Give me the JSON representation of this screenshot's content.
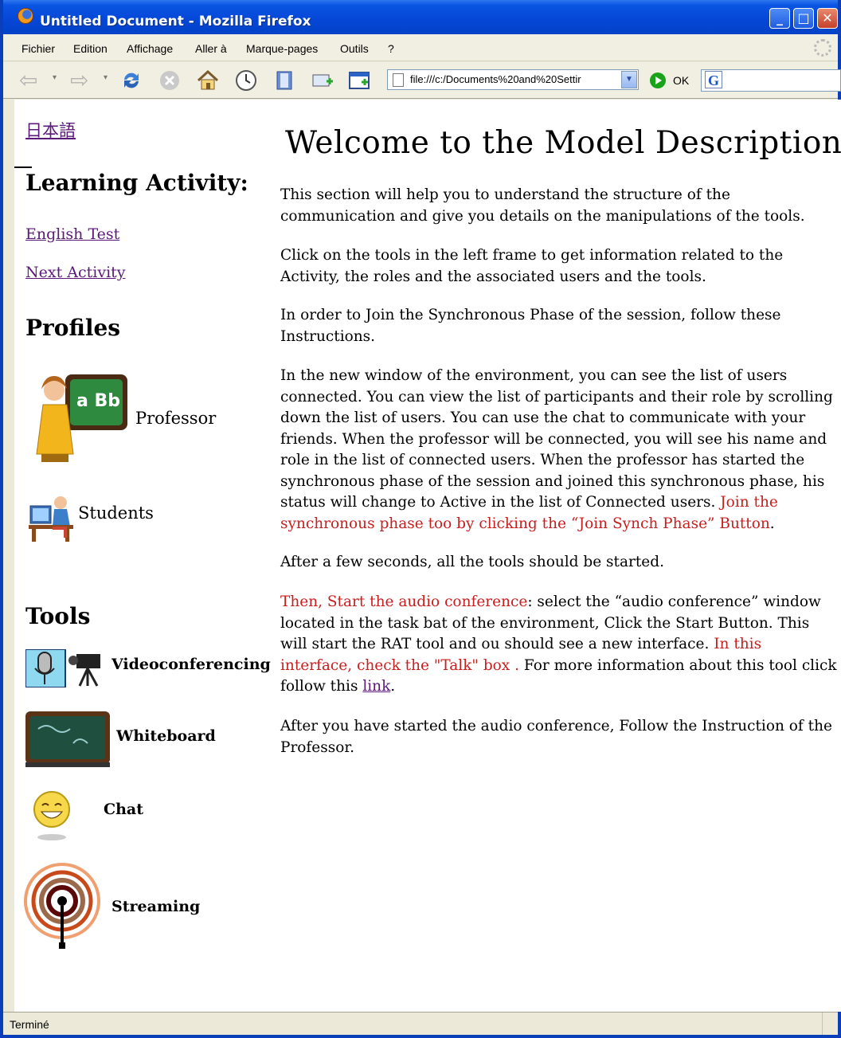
{
  "window": {
    "title": "Untitled Document - Mozilla Firefox",
    "controls": {
      "minimize": "_",
      "maximize": "□",
      "close": "✕"
    }
  },
  "menu": [
    "Fichier",
    "Edition",
    "Affichage",
    "Aller à",
    "Marque-pages",
    "Outils",
    "?"
  ],
  "toolbar": {
    "url": "file:///c:/Documents%20and%20Settir",
    "go_label": "OK",
    "icons": [
      "back-icon",
      "forward-icon",
      "reload-icon",
      "stop-icon",
      "home-icon",
      "history-icon",
      "bookmarks-icon",
      "new-tab-icon",
      "new-window-icon"
    ]
  },
  "left": {
    "language_link": "日本語",
    "learning_heading": "Learning Activity:",
    "links": [
      "English Test",
      "Next Activity"
    ],
    "profiles_heading": "Profiles",
    "profiles": [
      "Professor",
      "Students"
    ],
    "tools_heading": "Tools",
    "tools": [
      "Videoconferencing",
      "Whiteboard",
      "Chat",
      "Streaming"
    ]
  },
  "main": {
    "title": "Welcome to the Model Description",
    "p1": "This section will help you to understand the structure of the communication and give you details on the manipulations of the tools.",
    "p2": "Click on the tools in the left frame to get information related to the Activity, the roles and the associated users and the tools.",
    "p3": "In order to Join the Synchronous Phase of the session, follow these Instructions.",
    "p4": "In the new window of the environment, you can see the list of users connected. You can view the list of participants and their role by scrolling down the list of users. You can use the chat to communicate with your friends. When the professor will be connected, you will see his name and role in the list of connected users. When the professor has started the synchronous phase of the session and joined this synchronous phase, his status will change to Active in the list of Connected users. ",
    "p4_red": "Join the synchronous phase too by clicking the “Join Synch Phase” Button",
    "p4_end": ".",
    "p5": "After a few seconds, all the tools should be started.",
    "p6_red1": "Then, Start the audio conference",
    "p6_mid": ": select the “audio conference” window located in the task bat of the environment, Click the Start Button. This will start the RAT tool and ou should see a new interface. ",
    "p6_red2": "In this interface, check the \"Talk\" box .",
    "p6_end": " For more information about this tool click follow this ",
    "p6_link": "link",
    "p6_dot": ".",
    "p7": "After you have started the audio conference, Follow the Instruction of the Professor."
  },
  "status": "Terminé",
  "colors": {
    "title_bar": "#0546d6",
    "link": "#5a1878",
    "highlight_text": "#c81e1e"
  }
}
